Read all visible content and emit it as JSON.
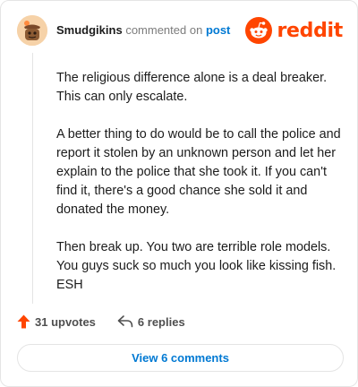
{
  "header": {
    "username": "Smudgikins",
    "action_text": "commented on",
    "post_link": "post",
    "brand": "reddit"
  },
  "comment": {
    "paragraphs": [
      "The religious difference alone is a deal breaker. This can only escalate.",
      "A better thing to do would be to call the police and report it stolen by an unknown person and let her explain to the police that she took it. If you can't find it, there's a good chance she sold it and donated the money.",
      "Then break up. You two are terrible role models. You guys suck so much you look like kissing fish. ESH"
    ]
  },
  "actions": {
    "upvotes": "31 upvotes",
    "replies": "6 replies"
  },
  "view_comments_label": "View 6 comments",
  "colors": {
    "brand": "#ff4500",
    "link": "#0079d3",
    "upvote": "#ff4500"
  },
  "icons": {
    "avatar": "snoo-avatar",
    "brand": "reddit-alien-icon",
    "upvote": "upvote-arrow-icon",
    "reply": "reply-arrow-icon"
  }
}
